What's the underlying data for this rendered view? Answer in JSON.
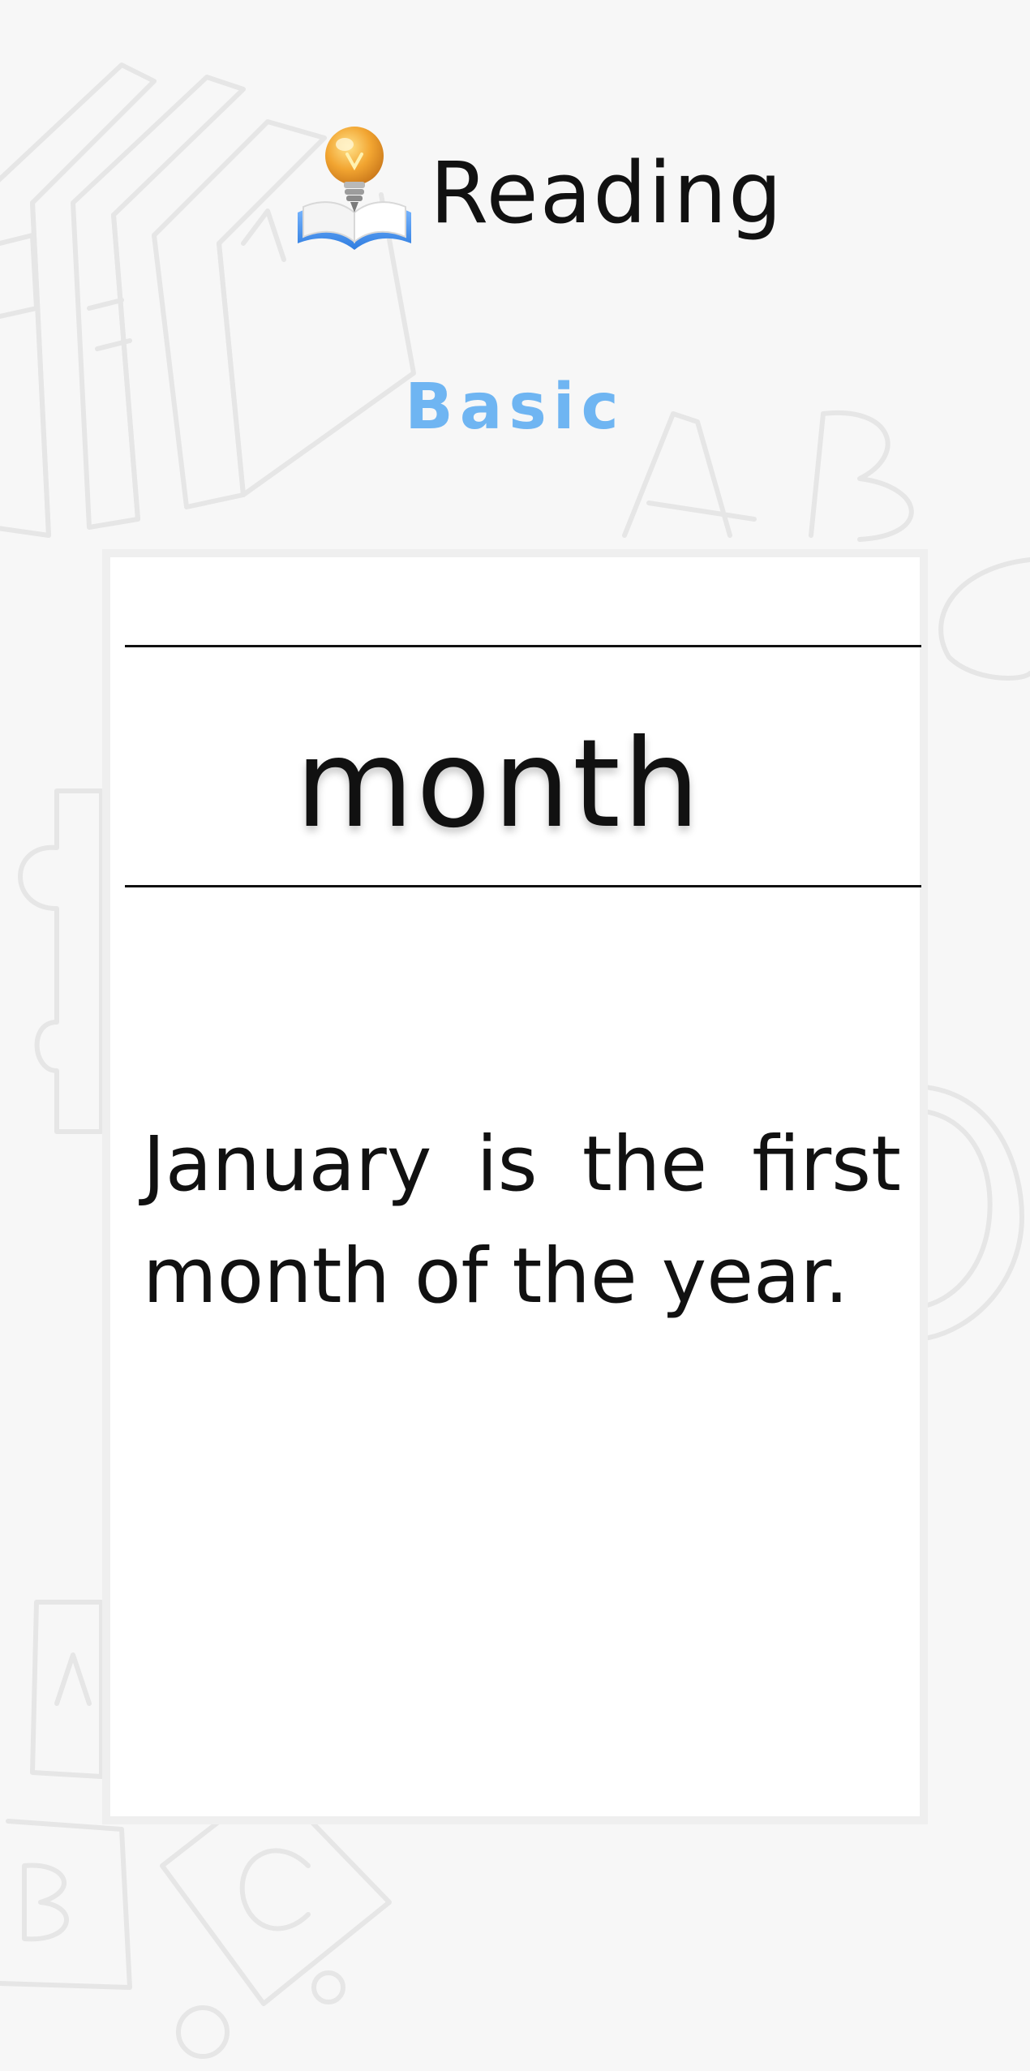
{
  "header": {
    "title": "Reading",
    "logo_icon": "book-lightbulb-icon"
  },
  "level": {
    "label": "Basic",
    "color": "#6fb5f2"
  },
  "card": {
    "word": "month",
    "sentence": "January is the first month of the year."
  },
  "background": {
    "decorations": [
      "books-sketch-icon",
      "letter-a-sketch-icon",
      "letter-b-sketch-icon",
      "puzzle-sketch-icon",
      "mug-sketch-icon",
      "abc-blocks-sketch-icon"
    ]
  }
}
